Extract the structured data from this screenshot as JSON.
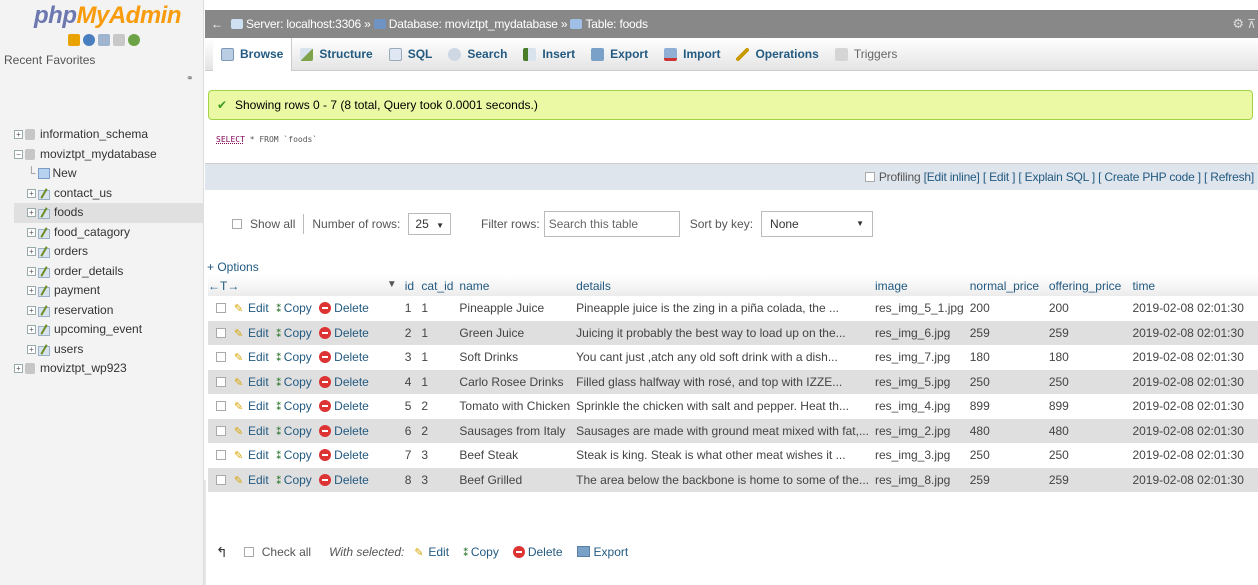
{
  "sidebar": {
    "logo_part1": "php",
    "logo_part2": "MyAdmin",
    "tab_recent": "Recent",
    "tab_favorites": "Favorites",
    "tree": {
      "db1": "information_schema",
      "db2": "moviztpt_mydatabase",
      "new_label": "New",
      "tables": [
        "contact_us",
        "foods",
        "food_catagory",
        "orders",
        "order_details",
        "payment",
        "reservation",
        "upcoming_event",
        "users"
      ],
      "db3": "moviztpt_wp923"
    }
  },
  "breadcrumb": {
    "server": "Server: localhost:3306 »",
    "database": "Database: moviztpt_mydatabase »",
    "table": "Table: foods"
  },
  "tabs": {
    "browse": "Browse",
    "structure": "Structure",
    "sql": "SQL",
    "search": "Search",
    "insert": "Insert",
    "export": "Export",
    "import": "Import",
    "operations": "Operations",
    "triggers": "Triggers"
  },
  "message": {
    "success": "Showing rows 0 - 7 (8 total, Query took 0.0001 seconds.)",
    "sql_select": "SELECT",
    "sql_rest": " * FROM `foods`"
  },
  "profiling": {
    "label": "Profiling",
    "edit_inline": "[Edit inline]",
    "edit": "[ Edit ]",
    "explain": "[ Explain SQL ]",
    "php": "[ Create PHP code ]",
    "refresh": "[ Refresh]"
  },
  "navrow": {
    "show_all": "Show all",
    "num_rows_label": "Number of rows:",
    "num_rows_value": "25",
    "filter_label": "Filter rows:",
    "filter_placeholder": "Search this table",
    "sort_label": "Sort by key:",
    "sort_value": "None"
  },
  "options_label": "+ Options",
  "table": {
    "columns": [
      "id",
      "cat_id",
      "name",
      "details",
      "image",
      "normal_price",
      "offering_price",
      "time"
    ],
    "action_labels": {
      "edit": "Edit",
      "copy": "Copy",
      "delete": "Delete"
    },
    "rows": [
      [
        "1",
        "1",
        "Pineapple Juice",
        "Pineapple juice is the zing in a piña colada, the ...",
        "res_img_5_1.jpg",
        "200",
        "200",
        "2019-02-08 02:01:30"
      ],
      [
        "2",
        "1",
        "Green Juice",
        "Juicing it probably the best way to load up on the...",
        "res_img_6.jpg",
        "259",
        "259",
        "2019-02-08 02:01:30"
      ],
      [
        "3",
        "1",
        "Soft Drinks",
        "You cant just ,atch any old soft drink with a dish...",
        "res_img_7.jpg",
        "180",
        "180",
        "2019-02-08 02:01:30"
      ],
      [
        "4",
        "1",
        "Carlo Rosee Drinks",
        "Filled  glass halfway with rosé, and top with IZZE...",
        "res_img_5.jpg",
        "250",
        "250",
        "2019-02-08 02:01:30"
      ],
      [
        "5",
        "2",
        "Tomato with Chicken",
        "Sprinkle the chicken with salt and pepper. Heat th...",
        "res_img_4.jpg",
        "899",
        "899",
        "2019-02-08 02:01:30"
      ],
      [
        "6",
        "2",
        "Sausages from Italy",
        "Sausages are made with ground meat mixed with fat,...",
        "res_img_2.jpg",
        "480",
        "480",
        "2019-02-08 02:01:30"
      ],
      [
        "7",
        "3",
        "Beef Steak",
        "Steak is king. Steak is what other meat wishes it ...",
        "res_img_3.jpg",
        "250",
        "250",
        "2019-02-08 02:01:30"
      ],
      [
        "8",
        "3",
        "Beef Grilled",
        "The area below the backbone is home to some of the...",
        "res_img_8.jpg",
        "259",
        "259",
        "2019-02-08 02:01:30"
      ]
    ]
  },
  "bottom": {
    "check_all": "Check all",
    "with_selected": "With selected:",
    "edit": "Edit",
    "copy": "Copy",
    "delete": "Delete",
    "export": "Export"
  }
}
